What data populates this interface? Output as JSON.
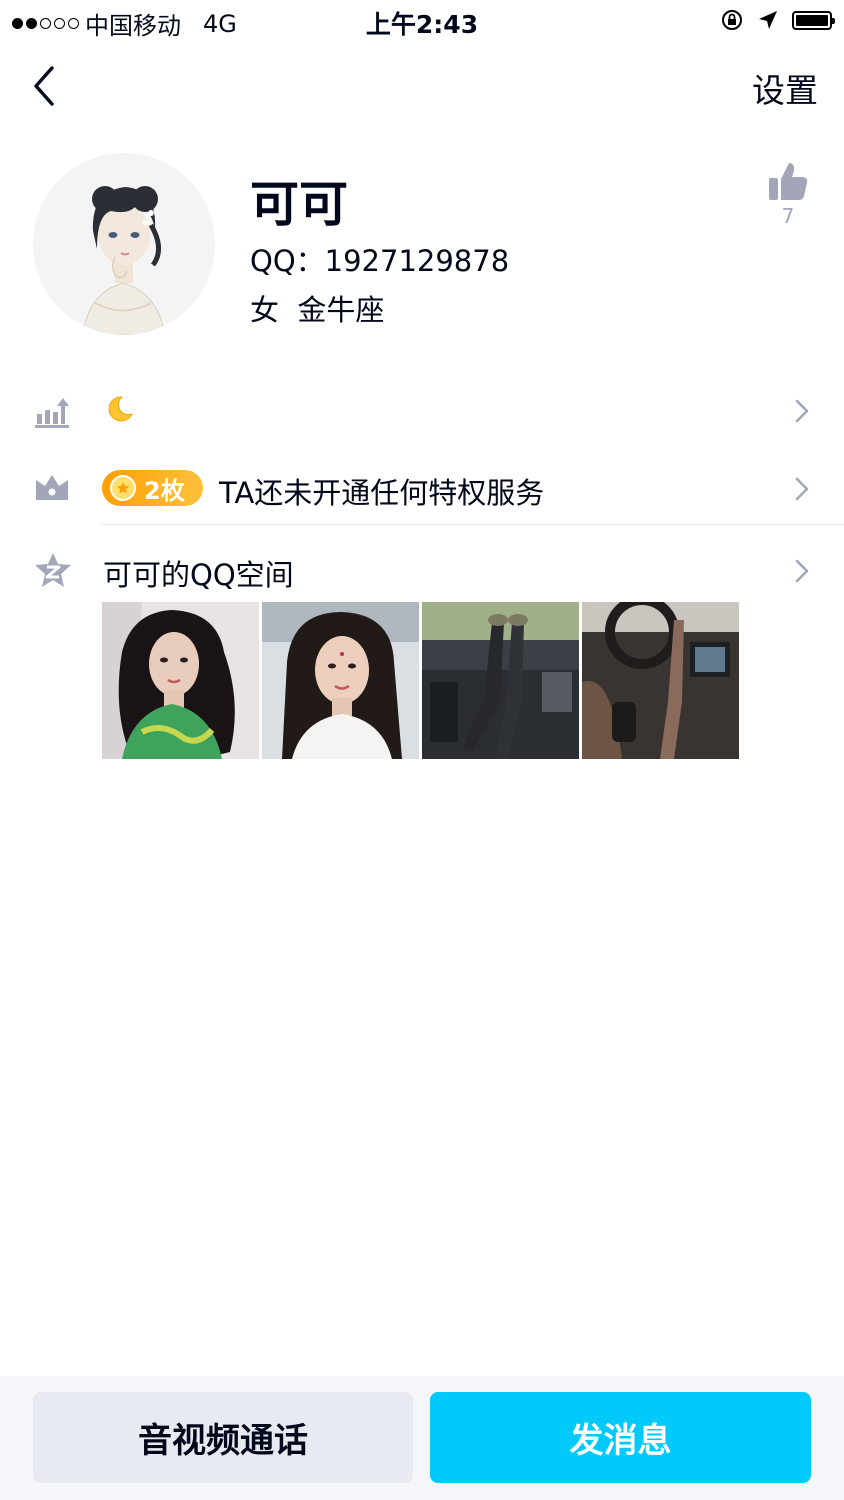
{
  "status_bar": {
    "carrier": "中国移动",
    "network": "4G",
    "time": "上午2:43",
    "signal_bars": 2,
    "signal_total": 5
  },
  "nav": {
    "back_icon": "chevron-left-icon",
    "settings_label": "设置"
  },
  "profile": {
    "name": "可可",
    "qq": "QQ：1927129878",
    "gender_zodiac": "女  金牛座",
    "like_count": "7"
  },
  "rows": {
    "level": {
      "icon": "level-icon",
      "value_icon": "moon-icon"
    },
    "privilege": {
      "icon": "crown-icon",
      "badge_label": "2枚",
      "text": "TA还未开通任何特权服务"
    },
    "qzone": {
      "icon": "qzone-star-icon",
      "title": "可可的QQ空间",
      "photos": [
        "photo-1",
        "photo-2",
        "photo-3",
        "photo-4"
      ]
    }
  },
  "bottom_bar": {
    "call_label": "音视频通话",
    "message_label": "发消息"
  },
  "colors": {
    "accent": "#00cafc",
    "text": "#03081a",
    "icon_gray": "#a2a6b8",
    "badge_orange": "#ff9d05"
  }
}
